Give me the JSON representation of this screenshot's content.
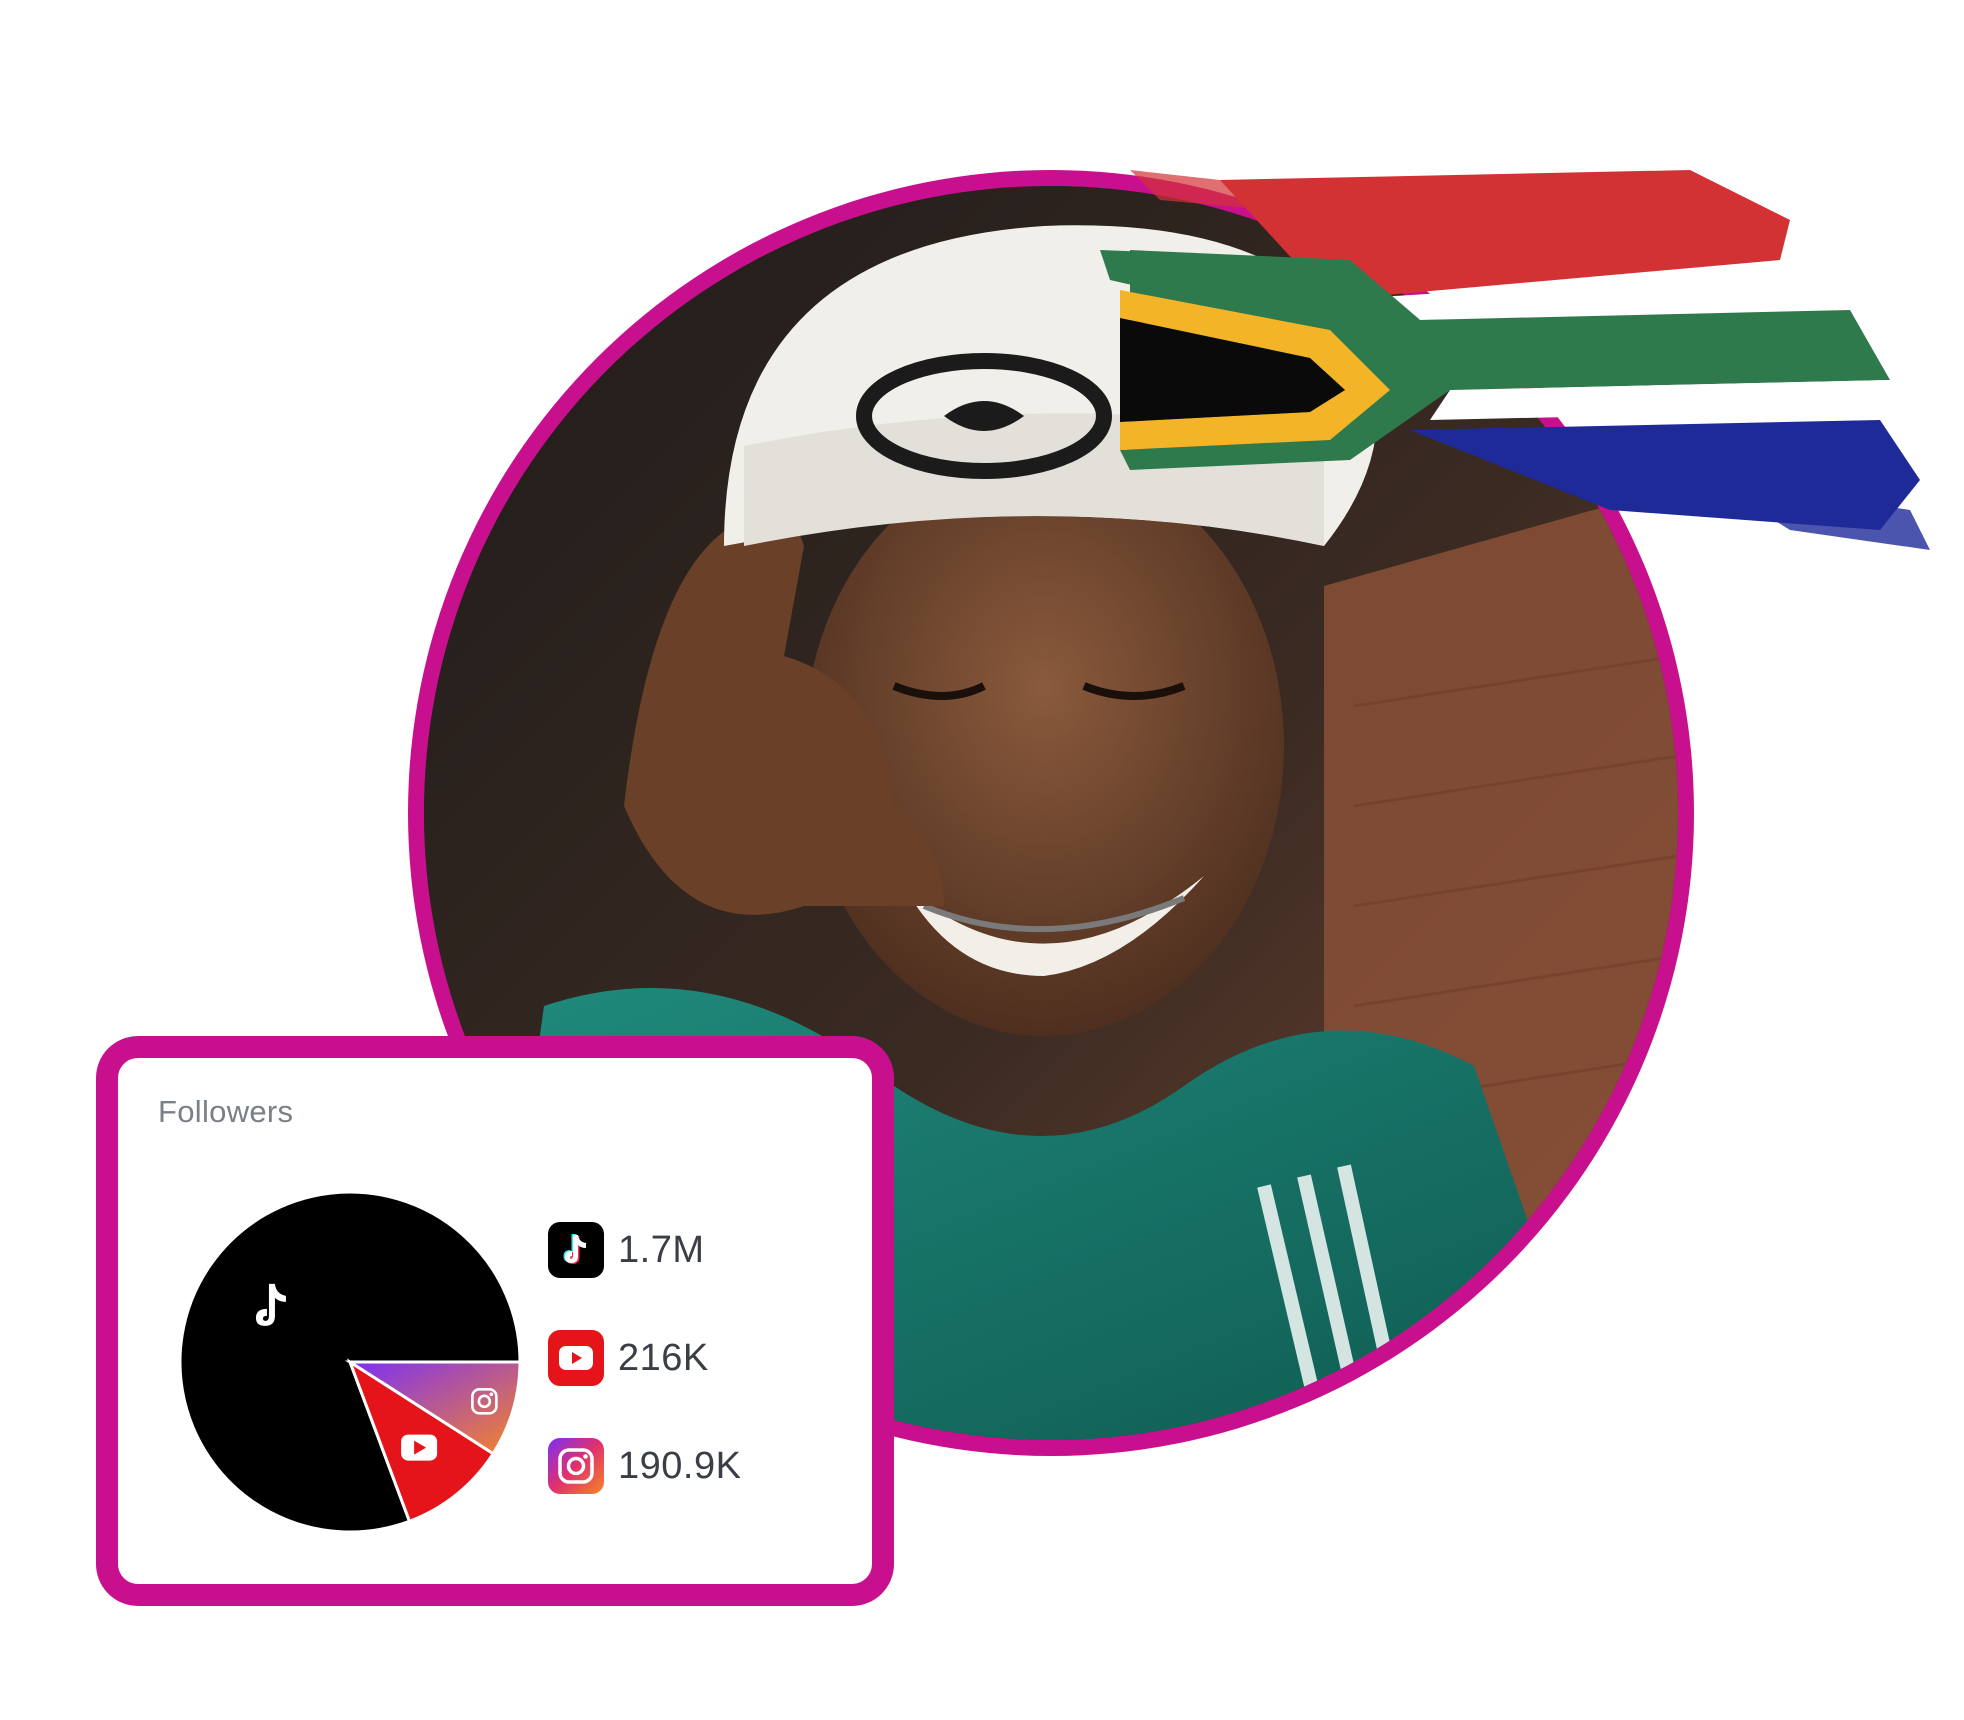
{
  "colors": {
    "accent": "#c8108f",
    "tiktok": "#000000",
    "youtube": "#e5141b",
    "instagram_start": "#7b2ff7",
    "instagram_end": "#f58529"
  },
  "profile": {
    "photo": "profile-photo",
    "flag": "south-africa-flag"
  },
  "followers": {
    "title": "Followers",
    "items": [
      {
        "platform": "tiktok",
        "icon": "tiktok-icon",
        "value": "1.7M"
      },
      {
        "platform": "youtube",
        "icon": "youtube-icon",
        "value": "216K"
      },
      {
        "platform": "instagram",
        "icon": "instagram-icon",
        "value": "190.9K"
      }
    ]
  },
  "chart_data": {
    "type": "pie",
    "categories": [
      "TikTok",
      "YouTube",
      "Instagram"
    ],
    "values": [
      1700000,
      216000,
      190900
    ]
  }
}
